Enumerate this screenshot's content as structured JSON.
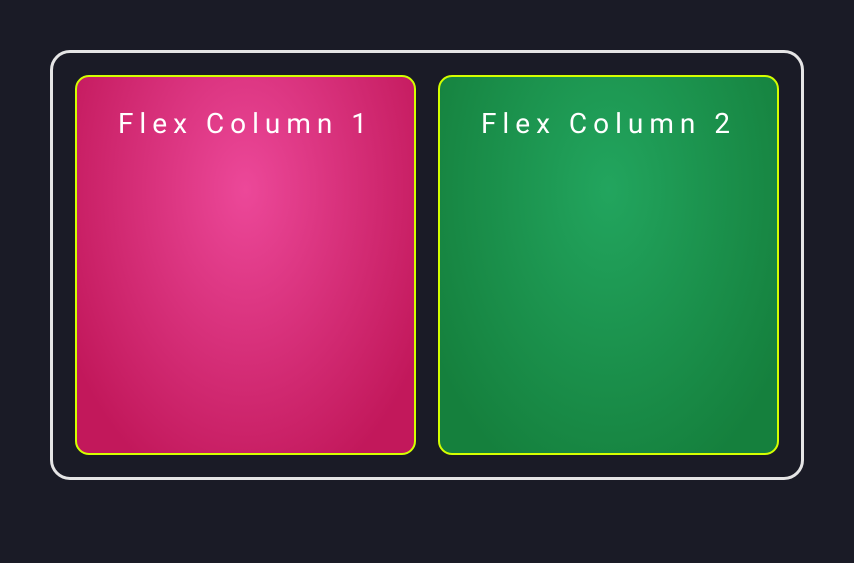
{
  "columns": [
    {
      "label": "Flex Column 1"
    },
    {
      "label": "Flex Column 2"
    }
  ]
}
